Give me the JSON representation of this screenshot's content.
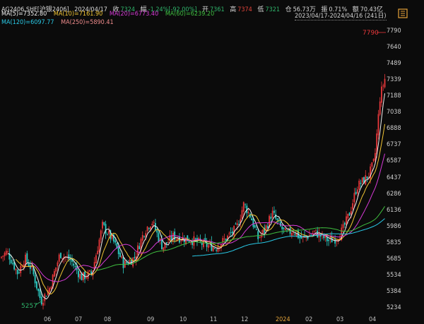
{
  "header": {
    "symbol": "AG2406.SHF[沪银2406]",
    "date": "2024/04/17",
    "close_label": "收",
    "close_value": "7324",
    "change_label": "幅",
    "change_value": "-1.24%[-92.00%]",
    "open_label": "开",
    "open_value": "7361",
    "high_label": "高",
    "high_value": "7374",
    "low_label": "低",
    "low_value": "7321",
    "position_label": "仓",
    "position_value": "56.73万",
    "amplitude_label": "振",
    "amplitude_value": "0.71%",
    "turnover_label": "额",
    "turnover_value": "70.43亿",
    "date_range": "2023/04/17-2024/04/16 (241日)"
  },
  "moving_averages": [
    {
      "label": "MA(5)=7352.80",
      "color": "#f0f0f0"
    },
    {
      "label": "MA(10)=7161.90",
      "color": "#f2c533"
    },
    {
      "label": "MA(20)=6773.40",
      "color": "#d63ad6"
    },
    {
      "label": "MA(60)=6239.20",
      "color": "#3fbf3f"
    },
    {
      "label": "MA(120)=6097.77",
      "color": "#29c9e6"
    },
    {
      "label": "MA(250)=5890.41",
      "color": "#ee8b8b"
    }
  ],
  "chart_data": {
    "type": "candlestick",
    "y_ticks": [
      "7790",
      "7640",
      "7489",
      "7339",
      "7188",
      "7038",
      "6888",
      "6737",
      "6587",
      "6437",
      "6286",
      "6136",
      "5986",
      "5835",
      "5685",
      "5534",
      "5384",
      "5234"
    ],
    "x_ticks": [
      "06",
      "07",
      "08",
      "09",
      "10",
      "11",
      "12",
      "2024",
      "02",
      "03",
      "04"
    ],
    "highlight_x_tick": "2024",
    "annotation_high": "7790",
    "annotation_low": "5257",
    "ylim": [
      5234,
      7790
    ],
    "colors": {
      "up": "#e8383b",
      "down": "#2dd0c8"
    }
  }
}
